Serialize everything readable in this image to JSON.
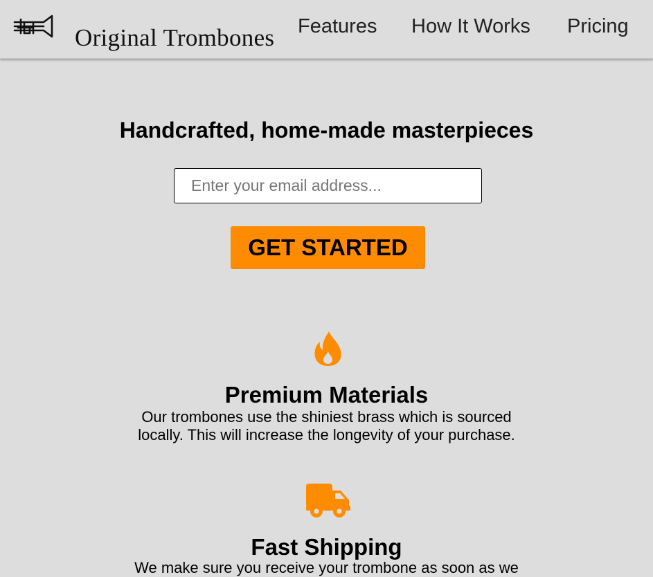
{
  "header": {
    "logo_icon": "trombone-icon",
    "brand": "Original Trombones",
    "nav": [
      {
        "label": "Features"
      },
      {
        "label": "How It Works"
      },
      {
        "label": "Pricing"
      }
    ]
  },
  "hero": {
    "title": "Handcrafted, home-made masterpieces",
    "email_placeholder": "Enter your email address...",
    "email_value": "",
    "cta_label": "GET STARTED"
  },
  "features": [
    {
      "icon": "fire-icon",
      "title": "Premium Materials",
      "description": "Our trombones use the shiniest brass which is sourced locally. This will increase the longevity of your purchase."
    },
    {
      "icon": "truck-icon",
      "title": "Fast Shipping",
      "description": "We make sure you receive your trombone as soon as we"
    }
  ],
  "colors": {
    "accent": "#ff8c00",
    "background": "#dddddd"
  }
}
